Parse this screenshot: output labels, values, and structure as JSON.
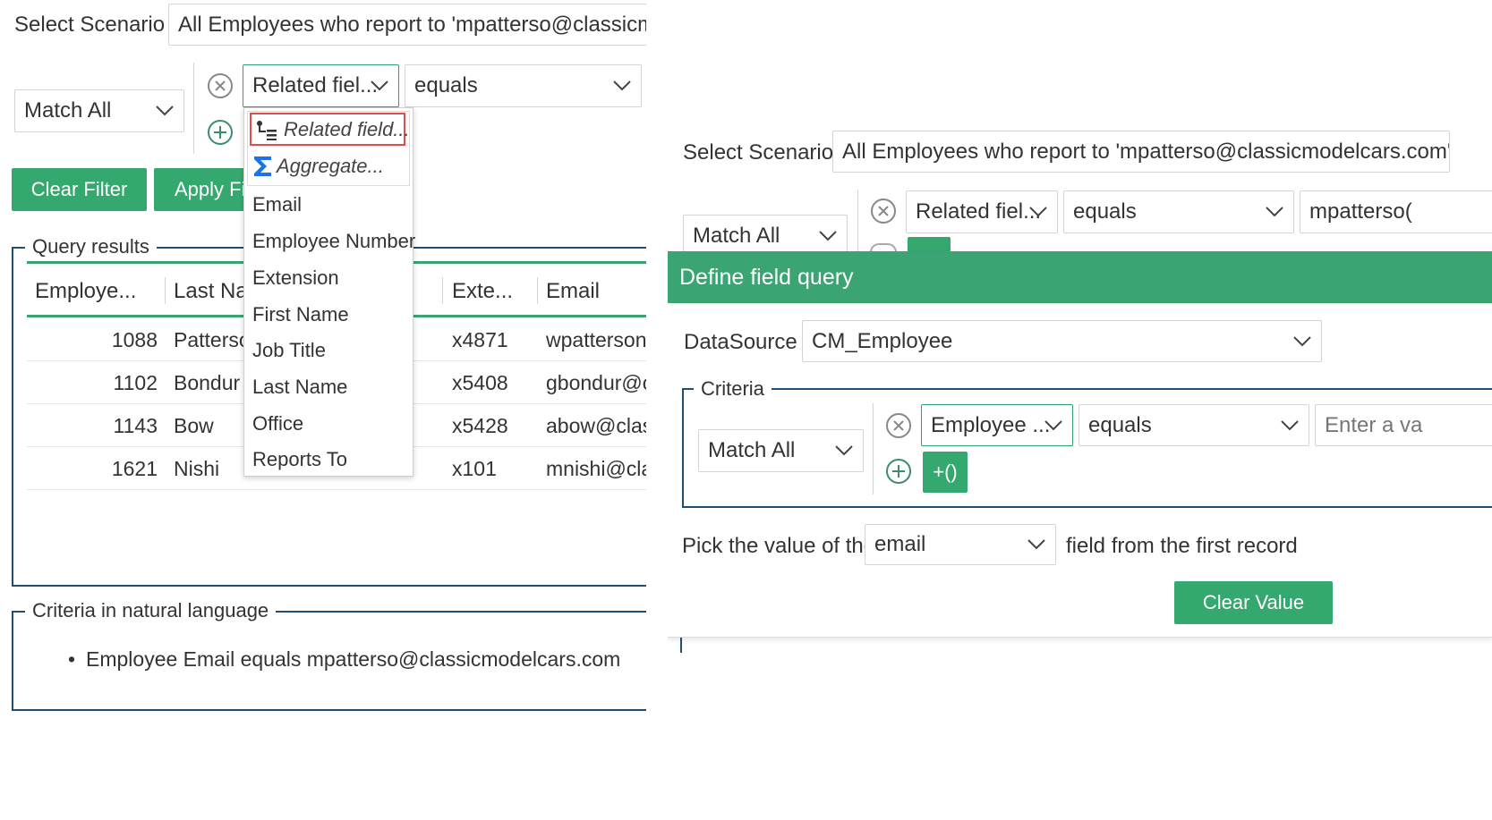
{
  "left": {
    "scenario_label": "Select Scenario :",
    "scenario_value": "All Employees who report to 'mpatterso@classicmod",
    "match_value": "Match All",
    "field_value": "Related fiel...",
    "operator_value": "equals",
    "clear_filter": "Clear Filter",
    "apply_filter": "Apply Fi",
    "dropdown": {
      "special": [
        {
          "label": "Related field...",
          "icon": "related-field-icon"
        },
        {
          "label": "Aggregate...",
          "icon": "sigma-icon"
        }
      ],
      "items": [
        "Email",
        "Employee Number",
        "Extension",
        "First Name",
        "Job Title",
        "Last Name",
        "Office",
        "Reports To"
      ]
    },
    "query_results": {
      "legend": "Query results",
      "headers": [
        "Employe...",
        "Last Na",
        "Exte...",
        "Email"
      ],
      "rows": [
        {
          "id": "1088",
          "last": "Patterso",
          "ext": "x4871",
          "email": "wpatterson"
        },
        {
          "id": "1102",
          "last": "Bondur",
          "ext": "x5408",
          "email": "gbondur@c"
        },
        {
          "id": "1143",
          "last": "Bow",
          "ext": "x5428",
          "email": "abow@clas"
        },
        {
          "id": "1621",
          "last": "Nishi",
          "ext": "x101",
          "email": "mnishi@cla"
        }
      ]
    },
    "natural": {
      "legend": "Criteria in natural language",
      "items": [
        "Employee Email equals mpatterso@classicmodelcars.com"
      ]
    }
  },
  "right": {
    "scenario_label": "Select Scenario :",
    "scenario_value": "All Employees who report to 'mpatterso@classicmodelcars.com'",
    "match_value": "Match All",
    "field_value": "Related fiel...",
    "operator_value": "equals",
    "value_text": "mpatterso(",
    "dialog": {
      "title": "Define field query",
      "datasource_label": "DataSource :",
      "datasource_value": "CM_Employee",
      "criteria_legend": "Criteria",
      "match_value": "Match All",
      "field_value": "Employee ...",
      "operator_value": "equals",
      "value_placeholder": "Enter a va",
      "group_button": "+()",
      "pick_prefix": "Pick the value of the",
      "pick_field": "email",
      "pick_suffix": "field from the first record",
      "clear_value": "Clear Value"
    }
  },
  "colors": {
    "accent": "#35a870",
    "header_green": "#3aa472",
    "border_blue": "#1e4f73",
    "highlight_red": "#e04b4b",
    "sigma_blue": "#1a73e8"
  }
}
